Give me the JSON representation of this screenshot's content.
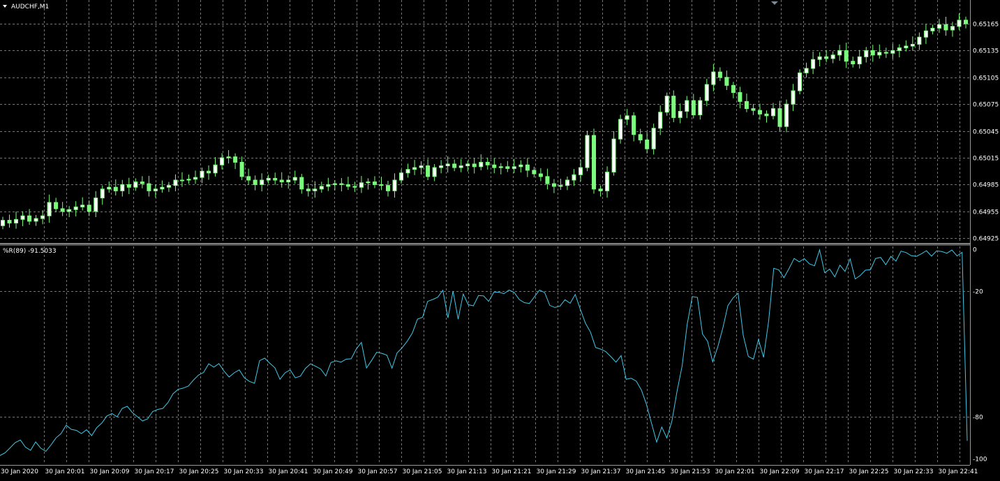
{
  "window": {
    "symbol_label": "AUDCHF,M1"
  },
  "indicator": {
    "label": "%R(89) -91.5033"
  },
  "colors": {
    "background": "#000000",
    "bull": "#ffffff",
    "bear": "#7cfc7c",
    "wick": "#7cfc7c",
    "wpr_line": "#40c8e8",
    "grid": "#8a8a8a",
    "text": "#ffffff",
    "separator": "#ffffff"
  },
  "chart_data": [
    {
      "type": "candlestick",
      "title": "AUDCHF,M1",
      "grid": true,
      "ylim": [
        0.64915,
        0.65185
      ],
      "y_ticks": [
        "0.65165",
        "0.65135",
        "0.65105",
        "0.65075",
        "0.65045",
        "0.65015",
        "0.64985",
        "0.64955",
        "0.64925"
      ],
      "x_ticks": [
        "30 Jan 2020",
        "30 Jan 20:01",
        "30 Jan 20:09",
        "30 Jan 20:17",
        "30 Jan 20:25",
        "30 Jan 20:33",
        "30 Jan 20:41",
        "30 Jan 20:49",
        "30 Jan 20:57",
        "30 Jan 21:05",
        "30 Jan 21:13",
        "30 Jan 21:21",
        "30 Jan 21:29",
        "30 Jan 21:37",
        "30 Jan 21:45",
        "30 Jan 21:53",
        "30 Jan 22:01",
        "30 Jan 22:09",
        "30 Jan 22:17",
        "30 Jan 22:25",
        "30 Jan 22:33",
        "30 Jan 22:41"
      ],
      "close": [
        0.64945,
        0.64942,
        0.64946,
        0.6495,
        0.64944,
        0.64947,
        0.6495,
        0.64965,
        0.64958,
        0.64955,
        0.64957,
        0.6496,
        0.64962,
        0.64955,
        0.6497,
        0.6498,
        0.64982,
        0.64978,
        0.64985,
        0.64982,
        0.64988,
        0.64986,
        0.64978,
        0.6498,
        0.64982,
        0.64984,
        0.6499,
        0.6499,
        0.64991,
        0.64993,
        0.65,
        0.64998,
        0.65007,
        0.65015,
        0.65016,
        0.6501,
        0.64994,
        0.6499,
        0.64985,
        0.6499,
        0.64992,
        0.6499,
        0.64988,
        0.6499,
        0.64993,
        0.6498,
        0.64978,
        0.6498,
        0.64983,
        0.64985,
        0.64986,
        0.64985,
        0.64983,
        0.64982,
        0.64987,
        0.64988,
        0.64985,
        0.64984,
        0.64978,
        0.6499,
        0.64998,
        0.65002,
        0.65004,
        0.65006,
        0.64994,
        0.65004,
        0.65006,
        0.65008,
        0.65004,
        0.65006,
        0.65008,
        0.65005,
        0.6501,
        0.65007,
        0.65004,
        0.65005,
        0.65003,
        0.65005,
        0.65007,
        0.65001,
        0.64997,
        0.64994,
        0.64986,
        0.64983,
        0.64984,
        0.6499,
        0.64996,
        0.65004,
        0.6504,
        0.6498,
        0.64978,
        0.64999,
        0.65036,
        0.65058,
        0.65062,
        0.65041,
        0.65035,
        0.65025,
        0.65048,
        0.65066,
        0.65084,
        0.6506,
        0.65067,
        0.65079,
        0.65063,
        0.65079,
        0.65097,
        0.65111,
        0.65105,
        0.65096,
        0.65088,
        0.65078,
        0.6507,
        0.65068,
        0.65064,
        0.65062,
        0.6507,
        0.6505,
        0.65075,
        0.6509,
        0.6511,
        0.65115,
        0.65125,
        0.65128,
        0.65126,
        0.6513,
        0.65135,
        0.65123,
        0.6512,
        0.65128,
        0.65135,
        0.6513,
        0.65133,
        0.65132,
        0.65135,
        0.65138,
        0.6514,
        0.65142,
        0.6515,
        0.65157,
        0.6516,
        0.65164,
        0.65158,
        0.65162,
        0.65169,
        0.65165
      ],
      "series": [
        {
          "name": "AUDCHF,M1"
        }
      ]
    },
    {
      "type": "line",
      "title": "%R(89) -91.5033",
      "grid": true,
      "ylim": [
        -100,
        0
      ],
      "y_ticks": [
        "0",
        "-20",
        "-80",
        "-100"
      ],
      "series": [
        {
          "name": "%R(89)",
          "values": [
            -98.5,
            -97.2,
            -94.8,
            -92.3,
            -91.1,
            -94.5,
            -96.0,
            -92.0,
            -95.0,
            -96.5,
            -93.5,
            -90.1,
            -88.0,
            -84.0,
            -86.0,
            -86.5,
            -88.0,
            -86.2,
            -89.0,
            -85.2,
            -83.0,
            -79.6,
            -78.5,
            -80.0,
            -76.0,
            -75.0,
            -78.0,
            -80.0,
            -82.0,
            -81.0,
            -77.5,
            -76.5,
            -76.0,
            -73.2,
            -69.0,
            -66.9,
            -66.3,
            -65.3,
            -62.5,
            -60.1,
            -58.8,
            -54.7,
            -56.3,
            -54.6,
            -58.2,
            -61.0,
            -59.0,
            -57.6,
            -61.4,
            -63.1,
            -64.0,
            -53.2,
            -52.0,
            -54.4,
            -56.6,
            -62.1,
            -59.0,
            -57.6,
            -61.4,
            -60.6,
            -56.9,
            -54.7,
            -55.9,
            -57.2,
            -60.5,
            -54.1,
            -53.3,
            -53.9,
            -52.5,
            -52.3,
            -47.6,
            -44.5,
            -56.7,
            -53.1,
            -49.2,
            -49.7,
            -50.6,
            -56.8,
            -49.5,
            -47.0,
            -43.9,
            -40.0,
            -33.4,
            -32.5,
            -24.9,
            -24.0,
            -22.9,
            -19.6,
            -32.8,
            -20.0,
            -33.4,
            -21.4,
            -26.5,
            -27.0,
            -22.1,
            -22.3,
            -24.9,
            -20.6,
            -20.5,
            -21.2,
            -19.5,
            -20.6,
            -24.0,
            -25.5,
            -25.9,
            -22.7,
            -19.5,
            -20.7,
            -26.8,
            -27.8,
            -27.2,
            -24.1,
            -25.8,
            -21.6,
            -28.7,
            -35.3,
            -39.6,
            -46.9,
            -47.7,
            -48.9,
            -51.3,
            -53.9,
            -50.8,
            -62.1,
            -61.6,
            -63.0,
            -67.2,
            -74.1,
            -83.2,
            -92.1,
            -84.9,
            -90.1,
            -82.0,
            -67.8,
            -55.7,
            -35.7,
            -22.6,
            -23.0,
            -40.5,
            -44.0,
            -53.8,
            -46.6,
            -37.5,
            -26.9,
            -23.3,
            -21.0,
            -41.0,
            -51.2,
            -52.5,
            -43.1,
            -51.6,
            -34.2,
            -9.1,
            -9.9,
            -13.6,
            -9.2,
            -4.4,
            -6.0,
            -4.5,
            -7.0,
            -7.9,
            -0.3,
            -11.2,
            -9.5,
            -13.2,
            -7.6,
            -10.6,
            -4.6,
            -14.2,
            -12.5,
            -10.0,
            -9.8,
            -4.4,
            -3.9,
            -7.4,
            -3.4,
            -5.7,
            -0.9,
            -1.6,
            -3.1,
            -3.4,
            -2.2,
            -0.7,
            -3.3,
            -0.8,
            -1.1,
            -1.9,
            -0.4,
            -3.2,
            -1.5,
            -91.5
          ]
        }
      ]
    }
  ]
}
